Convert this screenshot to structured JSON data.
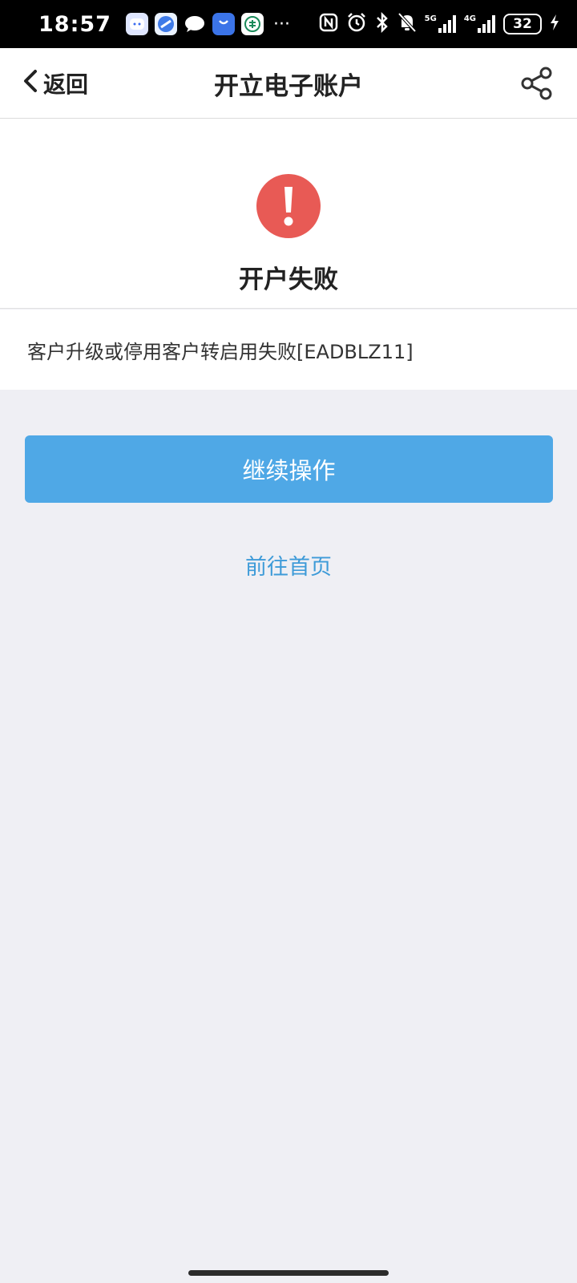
{
  "status_bar": {
    "time": "18:57",
    "more": "···",
    "network_5g": "5G",
    "network_4g": "4G",
    "battery": "32",
    "icons": [
      "nfc-icon",
      "alarm-icon",
      "bluetooth-icon",
      "mute-icon",
      "charging-icon"
    ]
  },
  "nav": {
    "back_label": "返回",
    "title": "开立电子账户"
  },
  "result": {
    "title": "开户失败",
    "message": "客户升级或停用客户转启用失败[EADBLZ11]",
    "icon": "exclamation-icon",
    "icon_color": "#e85a55"
  },
  "actions": {
    "continue_label": "继续操作",
    "home_label": "前往首页",
    "primary_color": "#4fa8e6",
    "link_color": "#3e9bd8"
  }
}
